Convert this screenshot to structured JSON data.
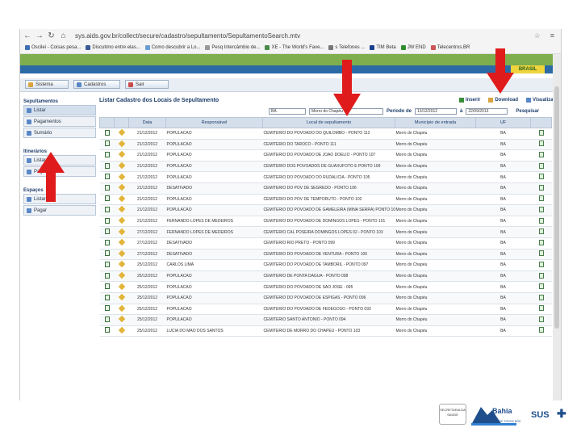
{
  "browser": {
    "url": "sys.aids.gov.br/collect/secure/cadastro/sepultamento/SepultamentoSearch.mtv",
    "bookmarks": [
      {
        "label": "Oscilei - Coisas pesa..."
      },
      {
        "label": "Discutimo entre elas..."
      },
      {
        "label": "Como descubrir a Lo..."
      },
      {
        "label": "Pesq Intercâmbio de..."
      },
      {
        "label": "XE - The World's Fave..."
      },
      {
        "label": "s Telefones ..."
      },
      {
        "label": "TIM Beta"
      },
      {
        "label": "JW END"
      },
      {
        "label": "Telecentros.BR"
      }
    ]
  },
  "header": {
    "brand": "BRASIL"
  },
  "menu": {
    "items": [
      {
        "label": "Sistema"
      },
      {
        "label": "Cadastros"
      },
      {
        "label": "Sair"
      }
    ]
  },
  "sidebar": {
    "sections": [
      {
        "title": "Sepultamentos",
        "items": [
          "Listar",
          "Pagamentos",
          "Sumário"
        ]
      },
      {
        "title": "Itinerários",
        "items": [
          "Listar",
          "Pagar"
        ]
      },
      {
        "title": "Espaços",
        "items": [
          "Listar",
          "Pagar"
        ]
      }
    ]
  },
  "main": {
    "title": "Listar Cadastro dos Locais de Sepultamento",
    "actions": [
      "Inserir",
      "Download",
      "Visualizar"
    ],
    "filters": {
      "uf": "BA",
      "municipio": "Morro do Chapéu",
      "periodo_label": "Período de",
      "date_from": "13/12/2012",
      "date_to_label": "à",
      "date_to": "22/09/2013",
      "search_label": "Pesquisar"
    },
    "columns": [
      "",
      "",
      "Data",
      "Responsável",
      "Local de sepultamento",
      "Município de entrada",
      "UF",
      ""
    ],
    "rows": [
      {
        "data": "21/12/2012",
        "resp": "POPULACAO",
        "local": "CEMITERIO DO POVOADO DO QUILOMBO - PONTO 112",
        "mun": "Morro do Chapéu",
        "uf": "BA"
      },
      {
        "data": "21/12/2012",
        "resp": "POPULACAO",
        "local": "CEMITERIO DO TAROCO - PONTO 111",
        "mun": "Morro do Chapéu",
        "uf": "BA"
      },
      {
        "data": "21/12/2012",
        "resp": "POPULACAO",
        "local": "CEMITERIO DO POVOADO DE JOAO DOELIO - PONTO 107",
        "mun": "Morro do Chapéu",
        "uf": "BA"
      },
      {
        "data": "21/12/2012",
        "resp": "POPULACAO",
        "local": "CEMITERIO DOS POVOADOS DE GUAXUFOTO E PONTO 109",
        "mun": "Morro do Chapéu",
        "uf": "BA"
      },
      {
        "data": "21/12/2012",
        "resp": "POPULACAO",
        "local": "CEMITERIO DO POVOADO DO RUDALICIA - PONTO 105",
        "mun": "Morro do Chapéu",
        "uf": "BA"
      },
      {
        "data": "21/12/2012",
        "resp": "DESATIVADO",
        "local": "CEMITERIO DO POV DE SEGREDO - PONTO 106",
        "mun": "Morro do Chapéu",
        "uf": "BA"
      },
      {
        "data": "21/12/2012",
        "resp": "POPULACAO",
        "local": "CEMITERIO DO POV DE TEMPORUTO - PONTO 102",
        "mun": "Morro do Chapéu",
        "uf": "BA"
      },
      {
        "data": "21/12/2012",
        "resp": "POPULACAO",
        "local": "CEMITERIO DO POVOADO DE GAMELEIRA (MINA SERRA) PONTO 101",
        "mun": "Morro do Chapéu",
        "uf": "BA"
      },
      {
        "data": "21/12/2012",
        "resp": "FERNANDO LOPES DE MEDEIROS",
        "local": "CEMITERIO DO POVOADO DE DOMINGOS LOPES - PONTO 101",
        "mun": "Morro do Chapéu",
        "uf": "BA"
      },
      {
        "data": "27/12/2012",
        "resp": "FERNANDO LOPES DE MEDEIROS",
        "local": "CEMITERIO CAL POSEIRA DOMINGOS LOPES 02 - PONTO 103",
        "mun": "Morro do Chapéu",
        "uf": "BA"
      },
      {
        "data": "27/12/2012",
        "resp": "DESATIVADO",
        "local": "CEMITERIO RIO PRETO - PONTO 099",
        "mun": "Morro do Chapéu",
        "uf": "BA"
      },
      {
        "data": "27/12/2012",
        "resp": "DESATIVADO",
        "local": "CEMITERIO DO POVOADO DE VENTURA - PONTO 100",
        "mun": "Morro do Chapéu",
        "uf": "BA"
      },
      {
        "data": "25/12/2012",
        "resp": "CARLOS LIMA",
        "local": "CEMITERIO DO POVOADO DE TAMBORIL - PONTO 097",
        "mun": "Morro do Chapéu",
        "uf": "BA"
      },
      {
        "data": "25/12/2012",
        "resp": "POPULACAO",
        "local": "CEMITERIO DE PONTA DAGUA - PONTO 098",
        "mun": "Morro do Chapéu",
        "uf": "BA"
      },
      {
        "data": "25/12/2012",
        "resp": "POPULACAO",
        "local": "CEMITERIO DO POVOADO DE SAO JOSE - 095",
        "mun": "Morro do Chapéu",
        "uf": "BA"
      },
      {
        "data": "25/12/2012",
        "resp": "POPULACAO",
        "local": "CEMITERIO DO POVOADO DE ESPIGAS - PONTO 096",
        "mun": "Morro do Chapéu",
        "uf": "BA"
      },
      {
        "data": "25/12/2012",
        "resp": "POPULACAO",
        "local": "CEMITERIO DO POVOADO DE FEDEGOSO - PONTO 093",
        "mun": "Morro do Chapéu",
        "uf": "BA"
      },
      {
        "data": "25/12/2012",
        "resp": "POPULACAO",
        "local": "CEMITERIO SANTO ANTONIO - PONTO 094",
        "mun": "Morro do Chapéu",
        "uf": "BA"
      },
      {
        "data": "25/12/2012",
        "resp": "LUCIA DO MAO DOS SANTOS",
        "local": "CEMITERIO DE MORRO DO CHAPEU - PONTO 103",
        "mun": "Morro do Chapéu",
        "uf": "BA"
      }
    ]
  },
  "footer": {
    "seal_text": "SECRETARIA DA SAÚDE",
    "logo_bahia": "Bahia",
    "logo_bahia_sub": "TERRA DE TODOS NÓS",
    "logo_sus": "SUS"
  },
  "colors": {
    "arrow": "#e01b1b",
    "header_green": "#7eae4e",
    "header_blue": "#2c6aa6"
  }
}
